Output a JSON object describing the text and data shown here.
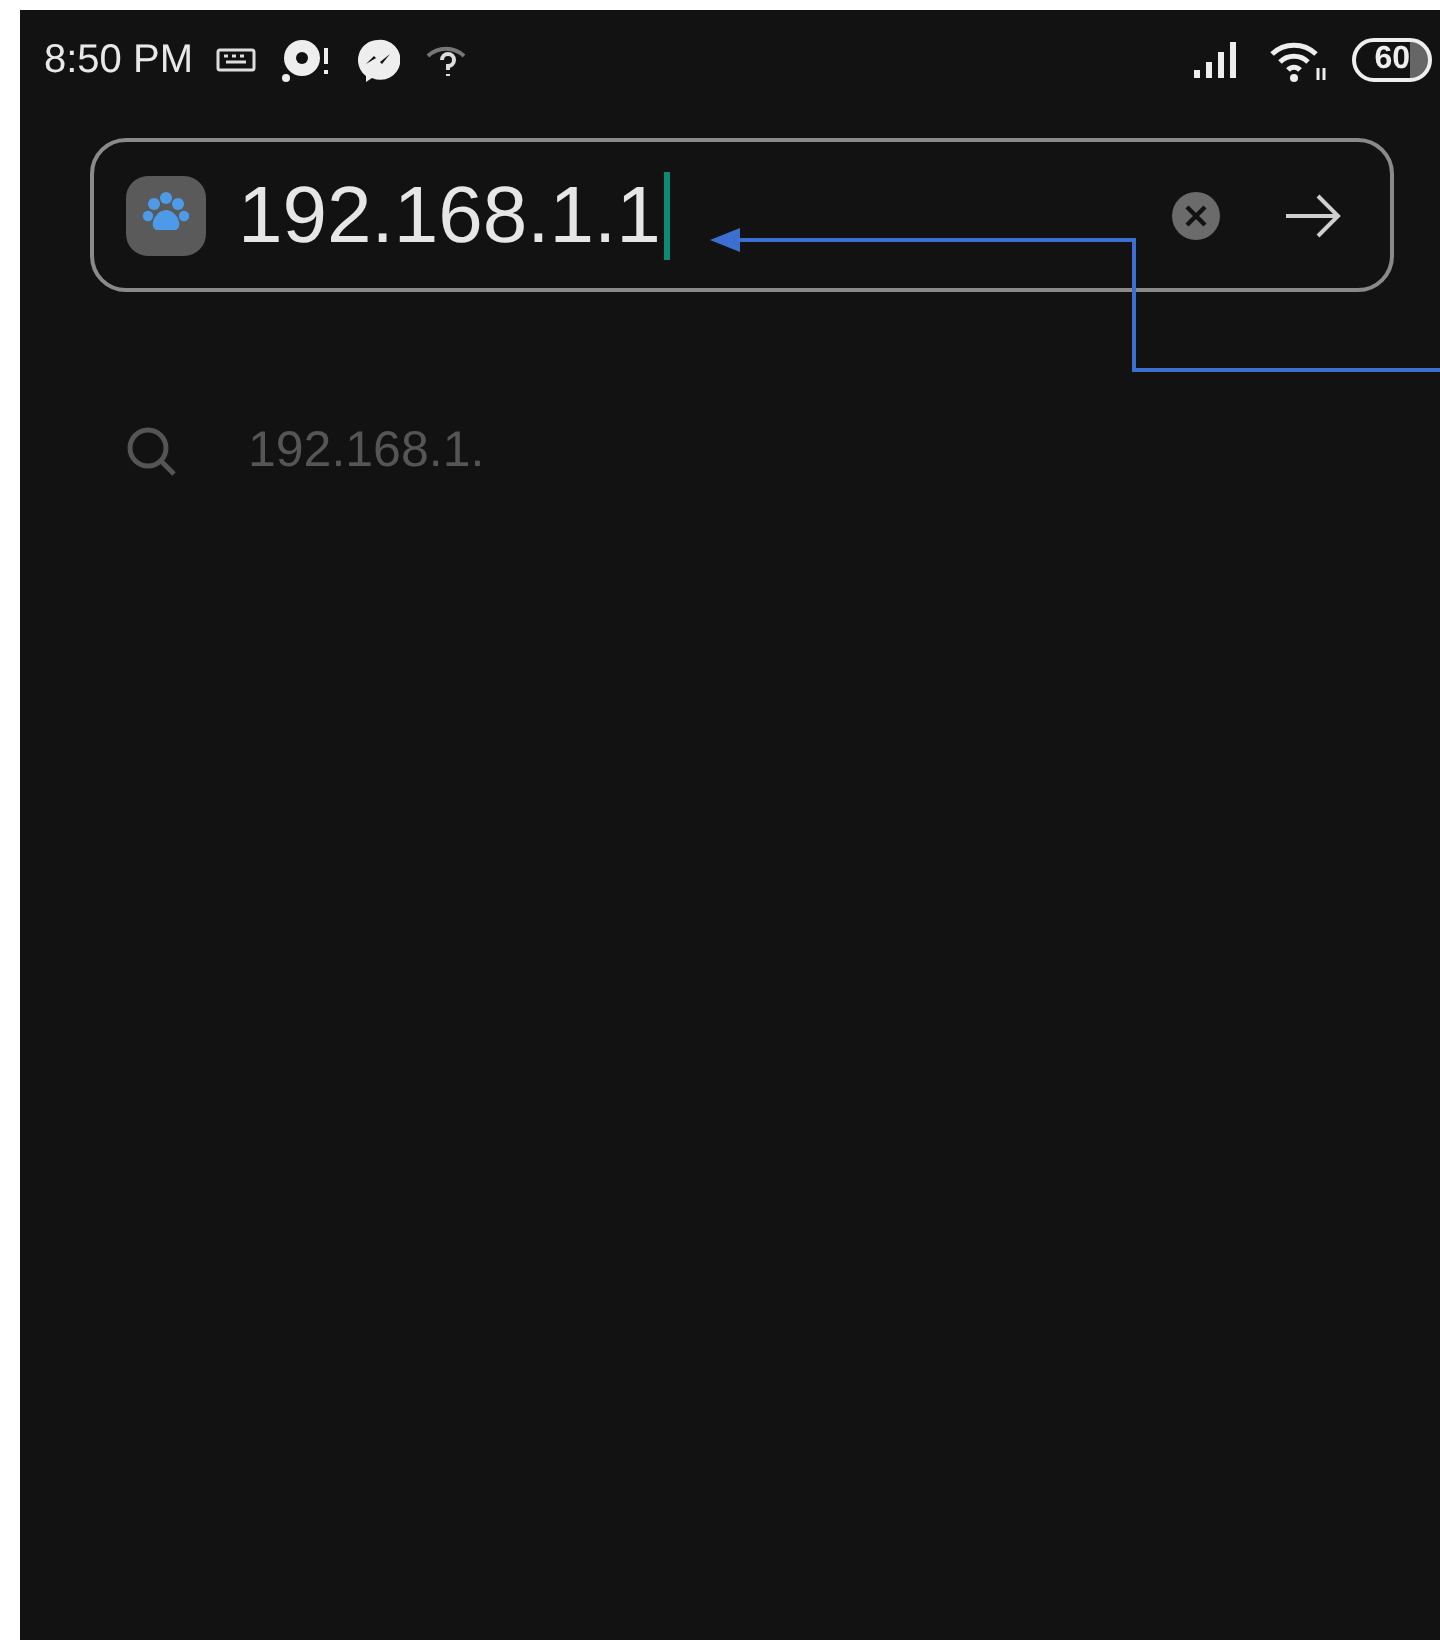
{
  "status_bar": {
    "time": "8:50 PM",
    "battery": "60"
  },
  "address_bar": {
    "value": "192.168.1.1"
  },
  "suggestions": [
    {
      "text": "192.168.1."
    }
  ]
}
